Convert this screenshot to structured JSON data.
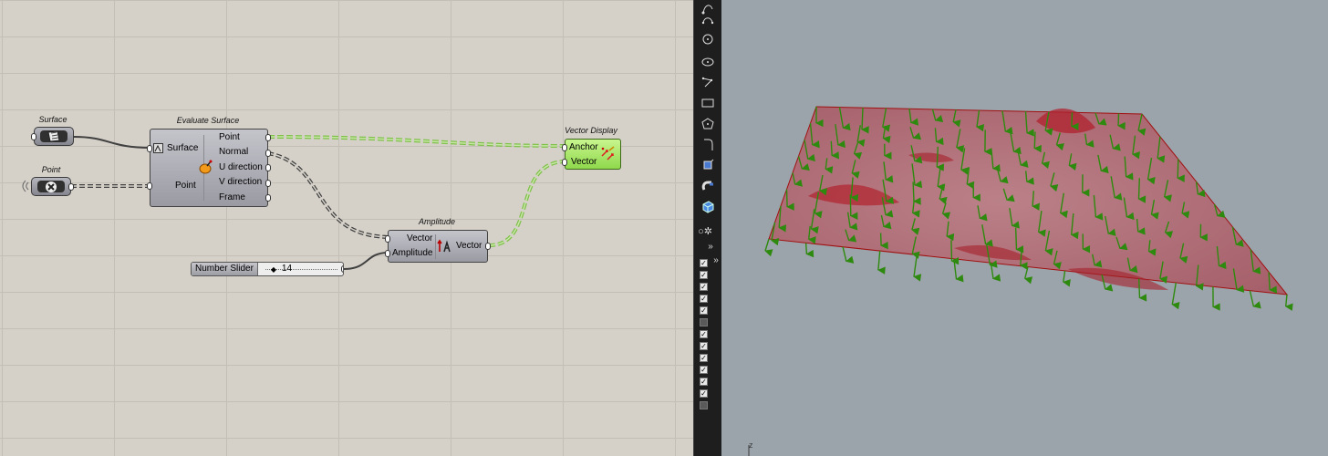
{
  "canvas": {
    "surface_param": {
      "title": "Surface"
    },
    "point_param": {
      "title": "Point"
    },
    "evaluate_surface": {
      "title": "Evaluate Surface",
      "inputs": [
        "Surface",
        "Point"
      ],
      "outputs": [
        "Point",
        "Normal",
        "U direction",
        "V direction",
        "Frame"
      ]
    },
    "amplitude": {
      "title": "Amplitude",
      "inputs": [
        "Vector",
        "Amplitude"
      ],
      "output": "Vector"
    },
    "vector_display": {
      "title": "Vector Display",
      "inputs": [
        "Anchor",
        "Vector"
      ]
    },
    "number_slider": {
      "name": "Number Slider",
      "value": "14"
    }
  },
  "toolbar": {
    "icons": [
      "curve-icon",
      "arc-icon",
      "circle-icon",
      "ellipse-icon",
      "polyline-icon",
      "rectangle-icon",
      "polygon-icon",
      "fillet-icon",
      "transform-icon",
      "magnet-icon",
      "box-icon",
      "settings-icon",
      "expand-icon",
      "expand-icon"
    ],
    "layer_checks": [
      true,
      true,
      true,
      true,
      true,
      false,
      true,
      true,
      true,
      true,
      true,
      true,
      false,
      false
    ]
  },
  "viewport": {
    "axis_label": "z",
    "colors": {
      "background": "#9ba3ab",
      "surface_fill": "#b05a65",
      "surface_edge": "#a01010",
      "vectors": "#2e8a0e"
    }
  }
}
